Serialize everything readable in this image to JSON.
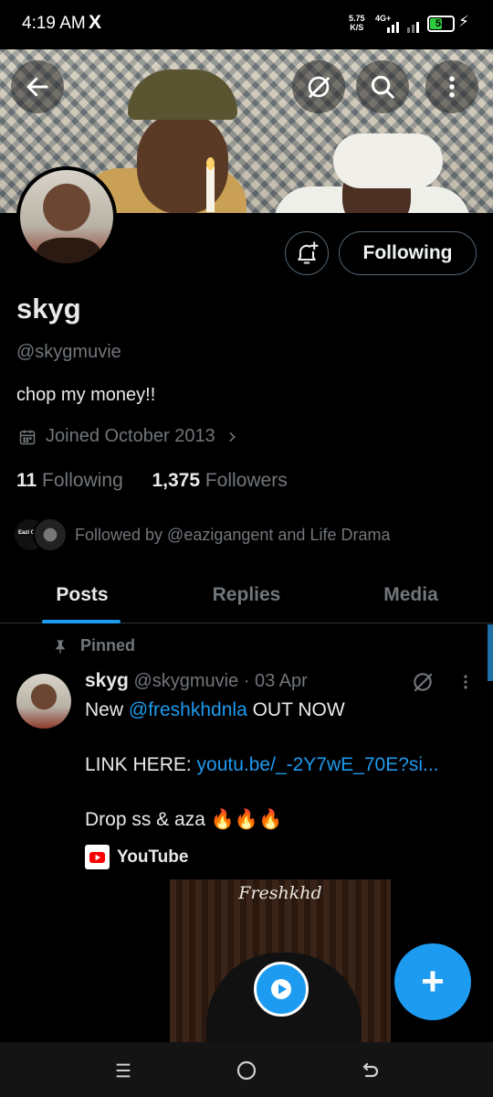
{
  "status_bar": {
    "time": "4:19 AM",
    "app_icon": "X",
    "speed_value": "5.75",
    "speed_unit": "K/S",
    "network": "4G+",
    "battery": "53",
    "battery_level": 0.53
  },
  "header": {
    "back_icon": "arrow-left-icon",
    "grok_icon": "grok-icon",
    "search_icon": "search-icon",
    "more_icon": "more-vertical-icon"
  },
  "profile": {
    "name": "skyg",
    "handle": "@skygmuvie",
    "bio": "chop my money!!",
    "joined": "Joined October 2013",
    "following_count": "11",
    "following_label": "Following",
    "followers_count": "1,375",
    "followers_label": "Followers",
    "followed_by": "Followed by @eazigangent and Life Drama",
    "follow_button": "Following",
    "mini_avatar_text": "Eazi Gang"
  },
  "tabs": [
    {
      "label": "Posts",
      "active": true
    },
    {
      "label": "Replies",
      "active": false
    },
    {
      "label": "Media",
      "active": false
    }
  ],
  "post": {
    "pinned_label": "Pinned",
    "author_name": "skyg",
    "author_meta": "@skygmuvie · 03 Apr",
    "line1_prefix": "New ",
    "line1_mention": "@freshkhdnla",
    "line1_suffix": " OUT NOW",
    "line2_prefix": "LINK HERE: ",
    "line2_link": "youtu.be/_-2Y7wE_70E?si...",
    "line3": "Drop ss & aza 🔥🔥🔥",
    "source_label": "YouTube",
    "video_title": "Freshkhd"
  },
  "fab": {
    "label": "+"
  },
  "colors": {
    "accent": "#1d9bf0",
    "background": "#000000",
    "muted_text": "#71767b"
  }
}
